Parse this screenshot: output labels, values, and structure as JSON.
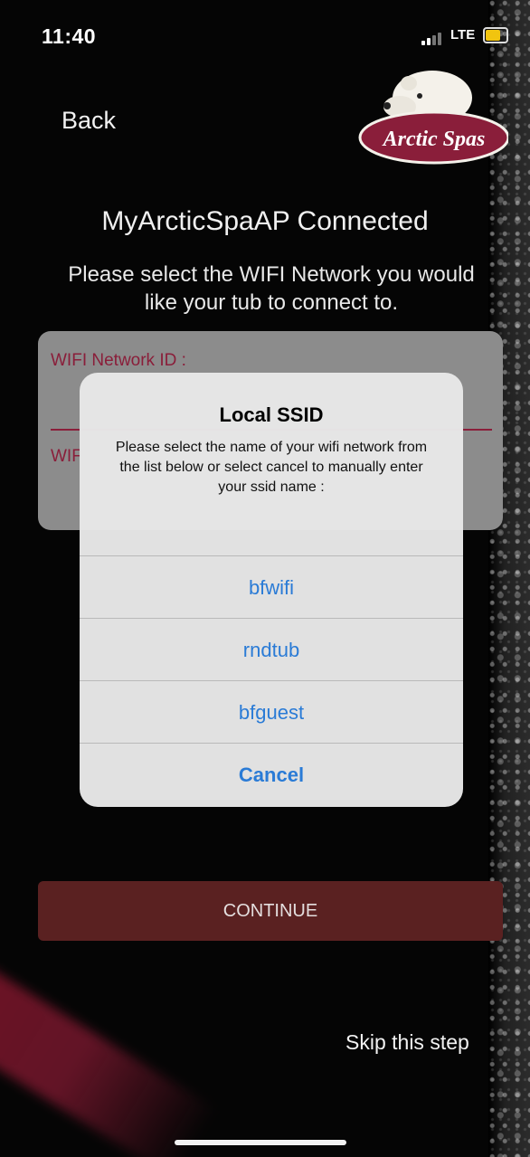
{
  "status_bar": {
    "time": "11:40",
    "network": "LTE",
    "battery_color": "#f1c40f"
  },
  "nav": {
    "back_label": "Back",
    "logo_text": "Arctic Spas"
  },
  "main": {
    "heading": "MyArcticSpaAP Connected",
    "instructions": "Please select the WIFI Network you would like your tub to connect to."
  },
  "form": {
    "network_id_label": "WIFI Network ID :",
    "password_label_partial": "WIF"
  },
  "alert": {
    "title": "Local SSID",
    "message": "Please select the name of your wifi network from the list below or select cancel to manually enter your ssid name :",
    "options": [
      "bfwifi",
      "rndtub",
      "bfguest"
    ],
    "cancel_label": "Cancel",
    "link_color": "#2a7bd6"
  },
  "actions": {
    "continue_label": "CONTINUE",
    "skip_label": "Skip this step"
  },
  "colors": {
    "accent": "#8a1e3a",
    "continue_bg": "#5a2121"
  }
}
